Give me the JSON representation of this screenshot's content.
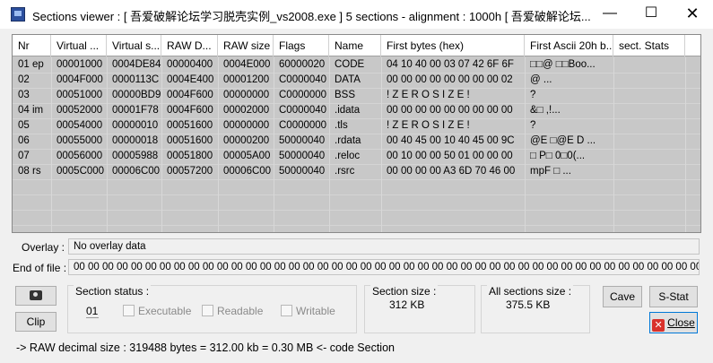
{
  "window": {
    "title": "Sections viewer : [ 吾爱破解论坛学习脱壳实例_vs2008.exe ] 5 sections - alignment : 1000h [ 吾爱破解论坛...",
    "min_glyph": "—",
    "max_glyph": "☐",
    "close_glyph": "✕"
  },
  "table": {
    "columns": [
      "Nr",
      "Virtual ...",
      "Virtual s...",
      "RAW D...",
      "RAW size",
      "Flags",
      "Name",
      "First bytes (hex)",
      "First Ascii 20h b...",
      "sect. Stats"
    ],
    "rows": [
      [
        "01 ep",
        "00001000",
        "0004DE84",
        "00000400",
        "0004E000",
        "60000020",
        "CODE",
        "04 10 40 00 03 07 42 6F 6F",
        "□□@ □□Boo...",
        ""
      ],
      [
        "02",
        "0004F000",
        "0000113C",
        "0004E400",
        "00001200",
        "C0000040",
        "DATA",
        "00 00 00 00 00 00 00 00 02",
        "@         ...",
        ""
      ],
      [
        "03",
        "00051000",
        "00000BD9",
        "0004F600",
        "00000000",
        "C0000000",
        "BSS",
        " ! Z E R O   S I Z E !",
        "?",
        ""
      ],
      [
        "04 im",
        "00052000",
        "00001F78",
        "0004F600",
        "00002000",
        "C0000040",
        ".idata",
        "00 00 00 00 00 00 00 00 00",
        "&□ ,!...",
        ""
      ],
      [
        "05",
        "00054000",
        "00000010",
        "00051600",
        "00000000",
        "C0000000",
        ".tls",
        " ! Z E R O   S I Z E !",
        "?",
        ""
      ],
      [
        "06",
        "00055000",
        "00000018",
        "00051600",
        "00000200",
        "50000040",
        ".rdata",
        "00 40 45 00 10 40 45 00 9C",
        "@E □@E  D ...",
        ""
      ],
      [
        "07",
        "00056000",
        "00005988",
        "00051800",
        "00005A00",
        "50000040",
        ".reloc",
        "00 10 00 00 50 01 00 00 00",
        "□ P□   0□0(...",
        ""
      ],
      [
        "08 rs",
        "0005C000",
        "00006C00",
        "00057200",
        "00006C00",
        "50000040",
        ".rsrc",
        "00 00 00 00 A3 6D 70 46 00",
        "mpF     □ ...",
        ""
      ]
    ]
  },
  "overlay": {
    "label": "Overlay :",
    "value": "No overlay data"
  },
  "end_of_file": {
    "label": "End of file :",
    "value": "00 00 00 00 00 00 00 00 00 00 00 00 00 00 00 00 00 00 00 00 00 00 00 00 00 00 00 00 00 00 00 00 00 00 00 00 00 00 00 00 00 00 00 00 00 00 00 00 00 00 00 00 00 00 00 00 00 00 00 00 00 00 00 00  |"
  },
  "section_status": {
    "title": "Section status :",
    "number": "01",
    "executable": "Executable",
    "readable": "Readable",
    "writable": "Writable"
  },
  "section_size": {
    "title": "Section size :",
    "value": "312 KB"
  },
  "all_sections_size": {
    "title": "All sections size :",
    "value": "375.5 KB"
  },
  "buttons": {
    "camera_icon": "camera-icon",
    "clip": "Clip",
    "cave": "Cave",
    "sstat": "S-Stat",
    "close": "Close"
  },
  "status_line": "->  RAW decimal size :     319488 bytes  =  312.00 kb  = 0.30 MB  <- code Section"
}
